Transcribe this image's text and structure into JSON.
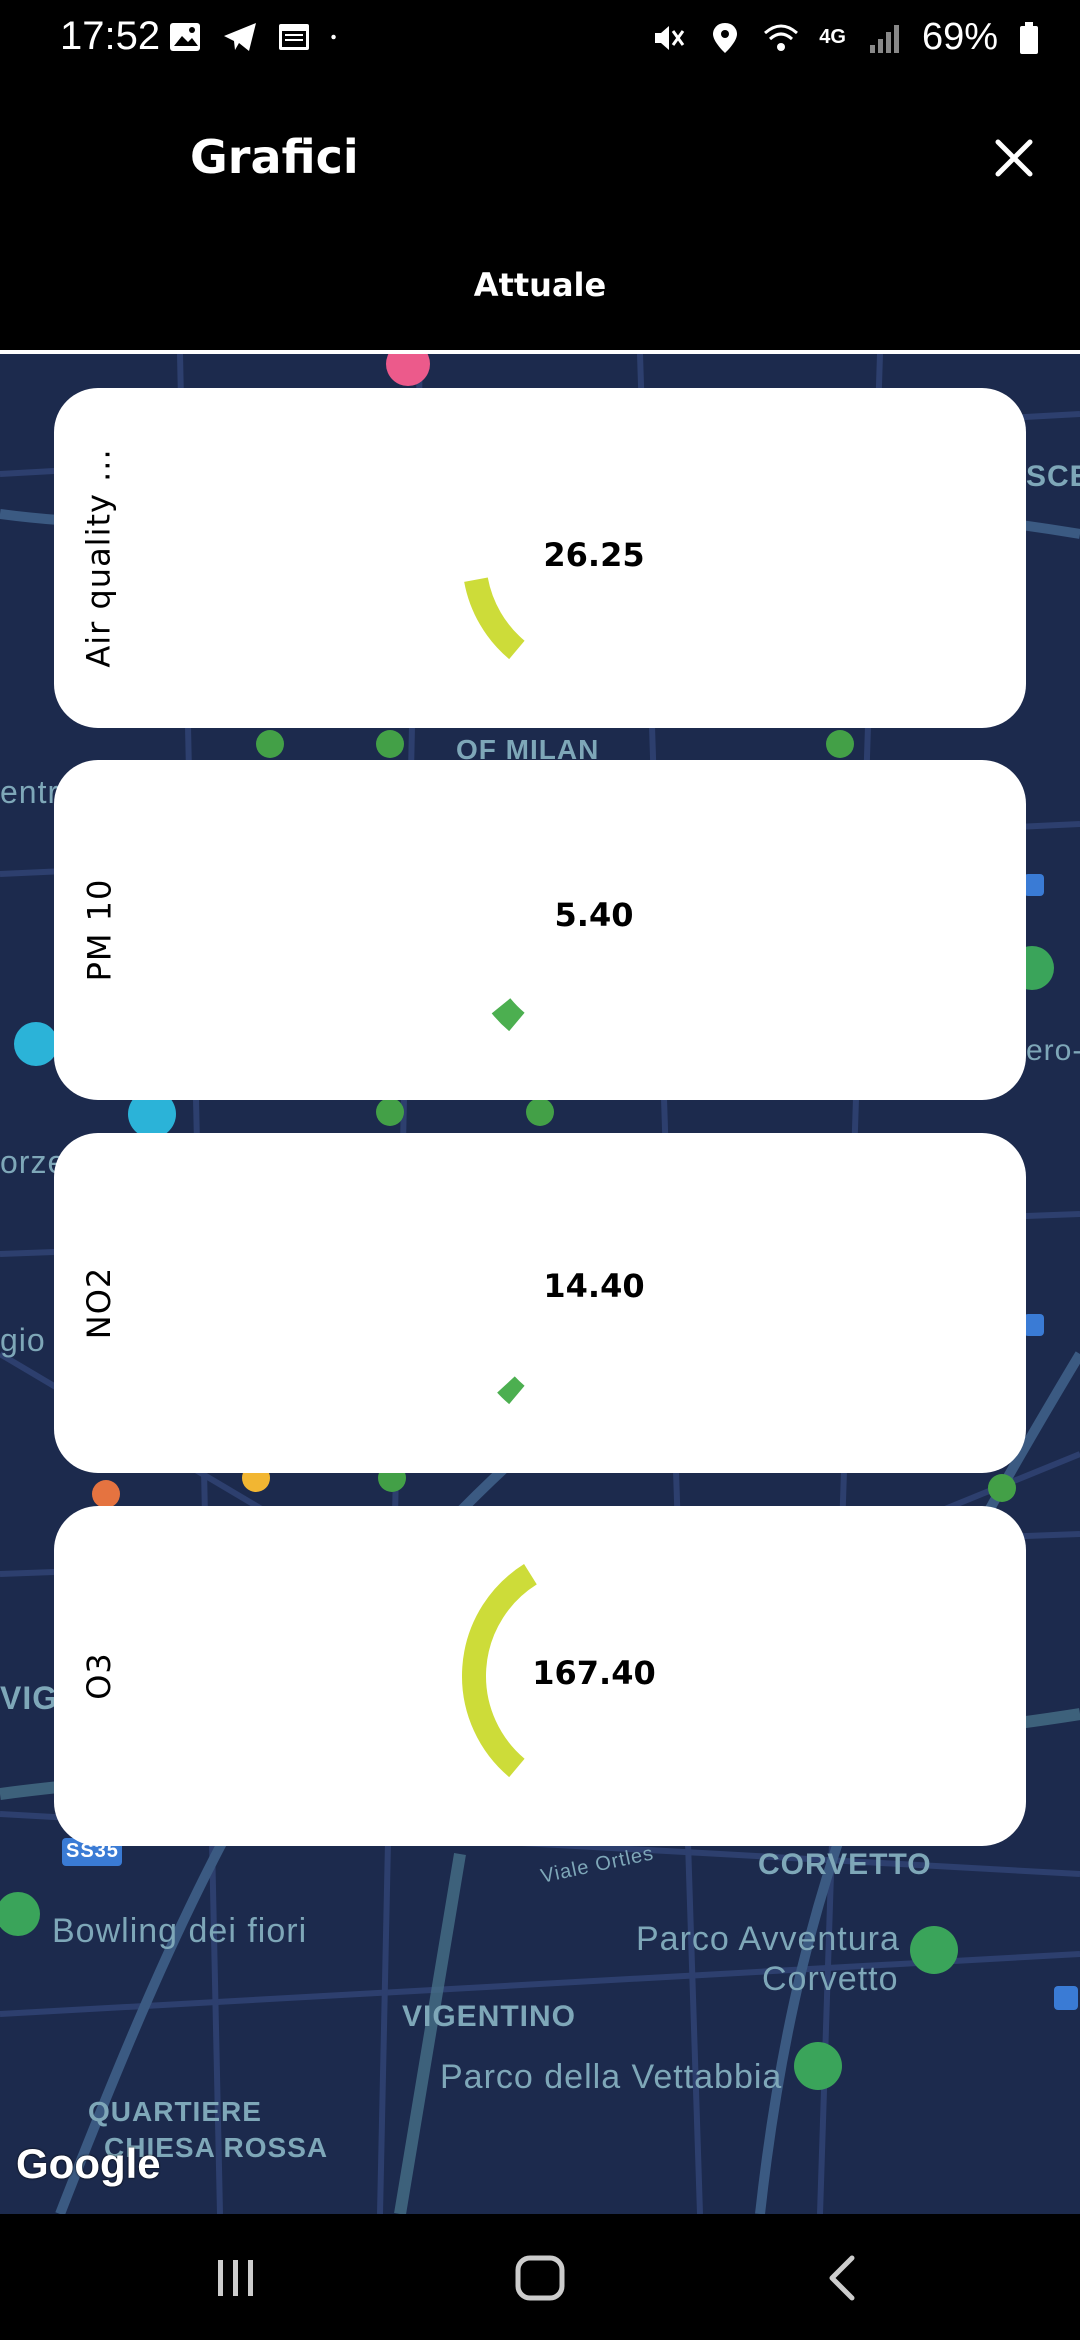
{
  "status_bar": {
    "time": "17:52",
    "battery": "69%",
    "network": "4G"
  },
  "header": {
    "title": "Grafici",
    "close_icon": "close-icon",
    "tab": "Attuale"
  },
  "map": {
    "labels": [
      "OF MILAN",
      "CORVETTO",
      "Bowling dei fiori",
      "Parco Avventura",
      "Corvetto",
      "VIGENTINO",
      "Parco della Vettabbia",
      "QUARTIERE",
      "CHIESA ROSSA",
      "Viale Ortles",
      "SS35",
      "SCE",
      "ero-",
      "entra",
      "orzes",
      "gio",
      "VIGL"
    ],
    "attribution": "Google"
  },
  "cards": [
    {
      "label": "Air quality ...",
      "value": "26.25",
      "gauge_fraction": 0.11,
      "color": "#cddc39"
    },
    {
      "label": "PM 10",
      "value": "5.40",
      "gauge_fraction": 0.03,
      "color": "#4caf50"
    },
    {
      "label": "NO2",
      "value": "14.40",
      "gauge_fraction": 0.02,
      "color": "#4caf50"
    },
    {
      "label": "O3",
      "value": "167.40",
      "gauge_fraction": 0.3,
      "color": "#cddc39"
    }
  ],
  "nav": {
    "recents_icon": "recents-icon",
    "home_icon": "home-icon",
    "back_icon": "back-icon"
  }
}
